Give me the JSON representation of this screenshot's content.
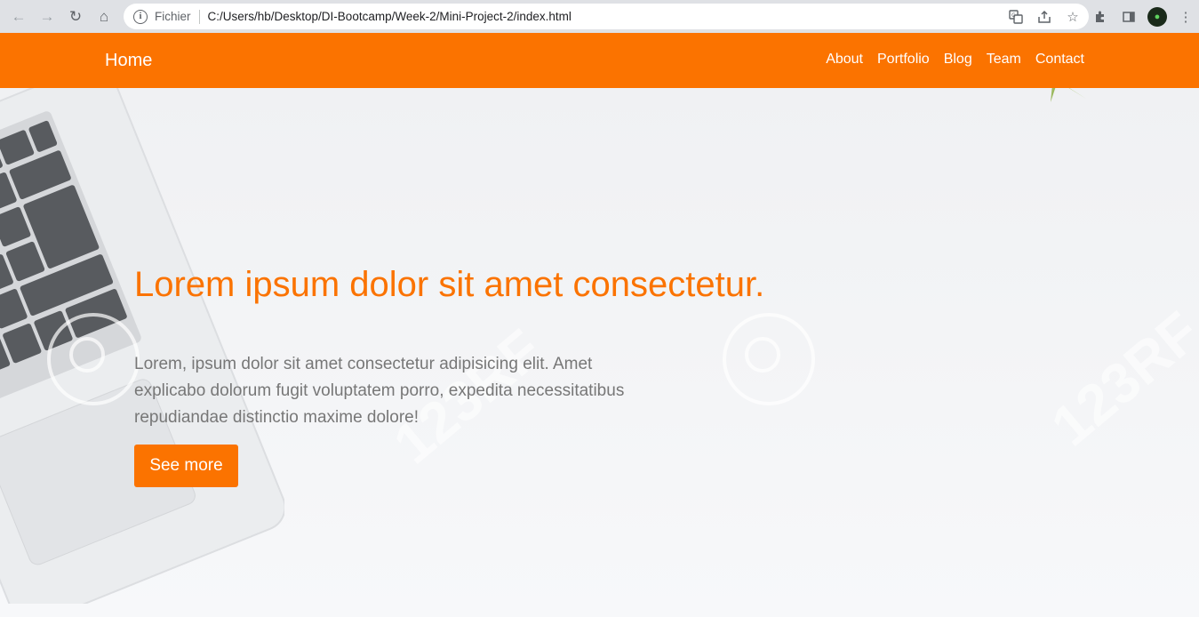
{
  "browser": {
    "scheme_label": "Fichier",
    "url": "C:/Users/hb/Desktop/DI-Bootcamp/Week-2/Mini-Project-2/index.html",
    "icons": [
      "back-icon",
      "forward-icon",
      "reload-icon",
      "home-icon",
      "info-icon",
      "translate-icon",
      "share-icon",
      "bookmark-star-icon",
      "extensions-icon",
      "side-panel-icon",
      "profile-avatar",
      "more-menu-icon"
    ]
  },
  "navbar": {
    "brand": "Home",
    "links": [
      "About",
      "Portfolio",
      "Blog",
      "Team",
      "Contact"
    ],
    "bg_color": "#fb7300"
  },
  "hero": {
    "title": "Lorem ipsum dolor sit amet consectetur.",
    "text": "Lorem, ipsum dolor sit amet consectetur adipisicing elit. Amet explicabo dolorum fugit voluptatem porro, expedita necessitatibus repudiandae distinctio maxime dolore!",
    "button": "See more",
    "accent": "#fb7300",
    "watermark": "123RF"
  }
}
